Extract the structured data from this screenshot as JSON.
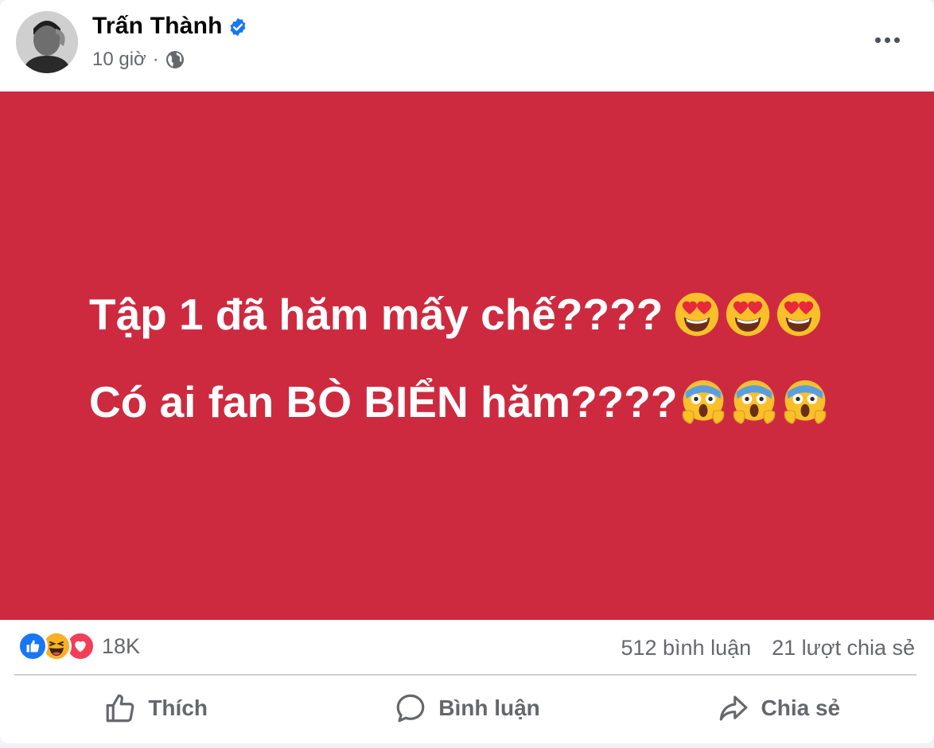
{
  "post": {
    "author": {
      "name": "Trấn Thành",
      "verified": true
    },
    "time": "10 giờ",
    "separator": "·",
    "privacy_icon": "globe-icon",
    "menu_icon": "more-horizontal-icon",
    "banner": {
      "background": "#cd2a3f",
      "line1": {
        "text": "Tập 1 đã hăm mấy chế????",
        "emoji": [
          "heart-eyes-emoji",
          "heart-eyes-emoji",
          "heart-eyes-emoji"
        ]
      },
      "line2": {
        "text": "Có ai fan BÒ BIỂN hăm????",
        "emoji": [
          "screaming-face-emoji",
          "screaming-face-emoji",
          "screaming-face-emoji"
        ]
      }
    },
    "stats": {
      "reactions": [
        "like-icon",
        "haha-icon",
        "love-icon"
      ],
      "reaction_count": "18K",
      "comments": "512 bình luận",
      "shares": "21 lượt chia sẻ"
    },
    "actions": {
      "like": "Thích",
      "comment": "Bình luận",
      "share": "Chia sẻ"
    }
  },
  "colors": {
    "brand_blue": "#1877f2",
    "banner_red": "#cd2a3f",
    "text_secondary": "#65676b"
  }
}
